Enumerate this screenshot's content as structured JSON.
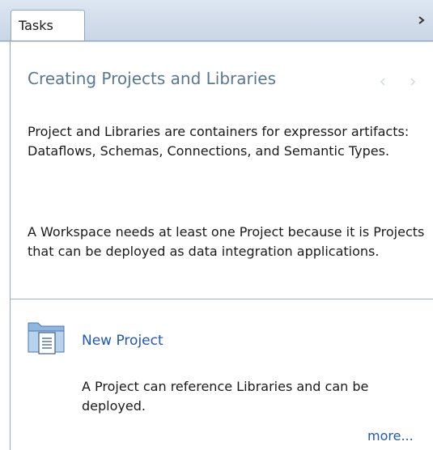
{
  "panel": {
    "tab_label": "Tasks",
    "collapse_icon": "chevron-right-icon"
  },
  "section": {
    "title": "Creating Projects and Libraries",
    "prev_icon": "chevron-left-icon",
    "next_icon": "chevron-right-icon",
    "paragraph1": "Project and Libraries are containers for expressor artifacts: Dataflows, Schemas, Connections, and Semantic Types.",
    "paragraph2": "A Workspace needs at least one Project because it is Projects that can be deployed as data integration applications."
  },
  "task": {
    "icon": "folder-document-icon",
    "link_label": "New Project",
    "description": "A Project can reference Libraries and can be deployed.",
    "more_label": "more..."
  },
  "colors": {
    "header_bg": "#d3deeb",
    "title_text": "#577795",
    "link_text": "#1f58b5",
    "border": "#8ea7c6"
  }
}
